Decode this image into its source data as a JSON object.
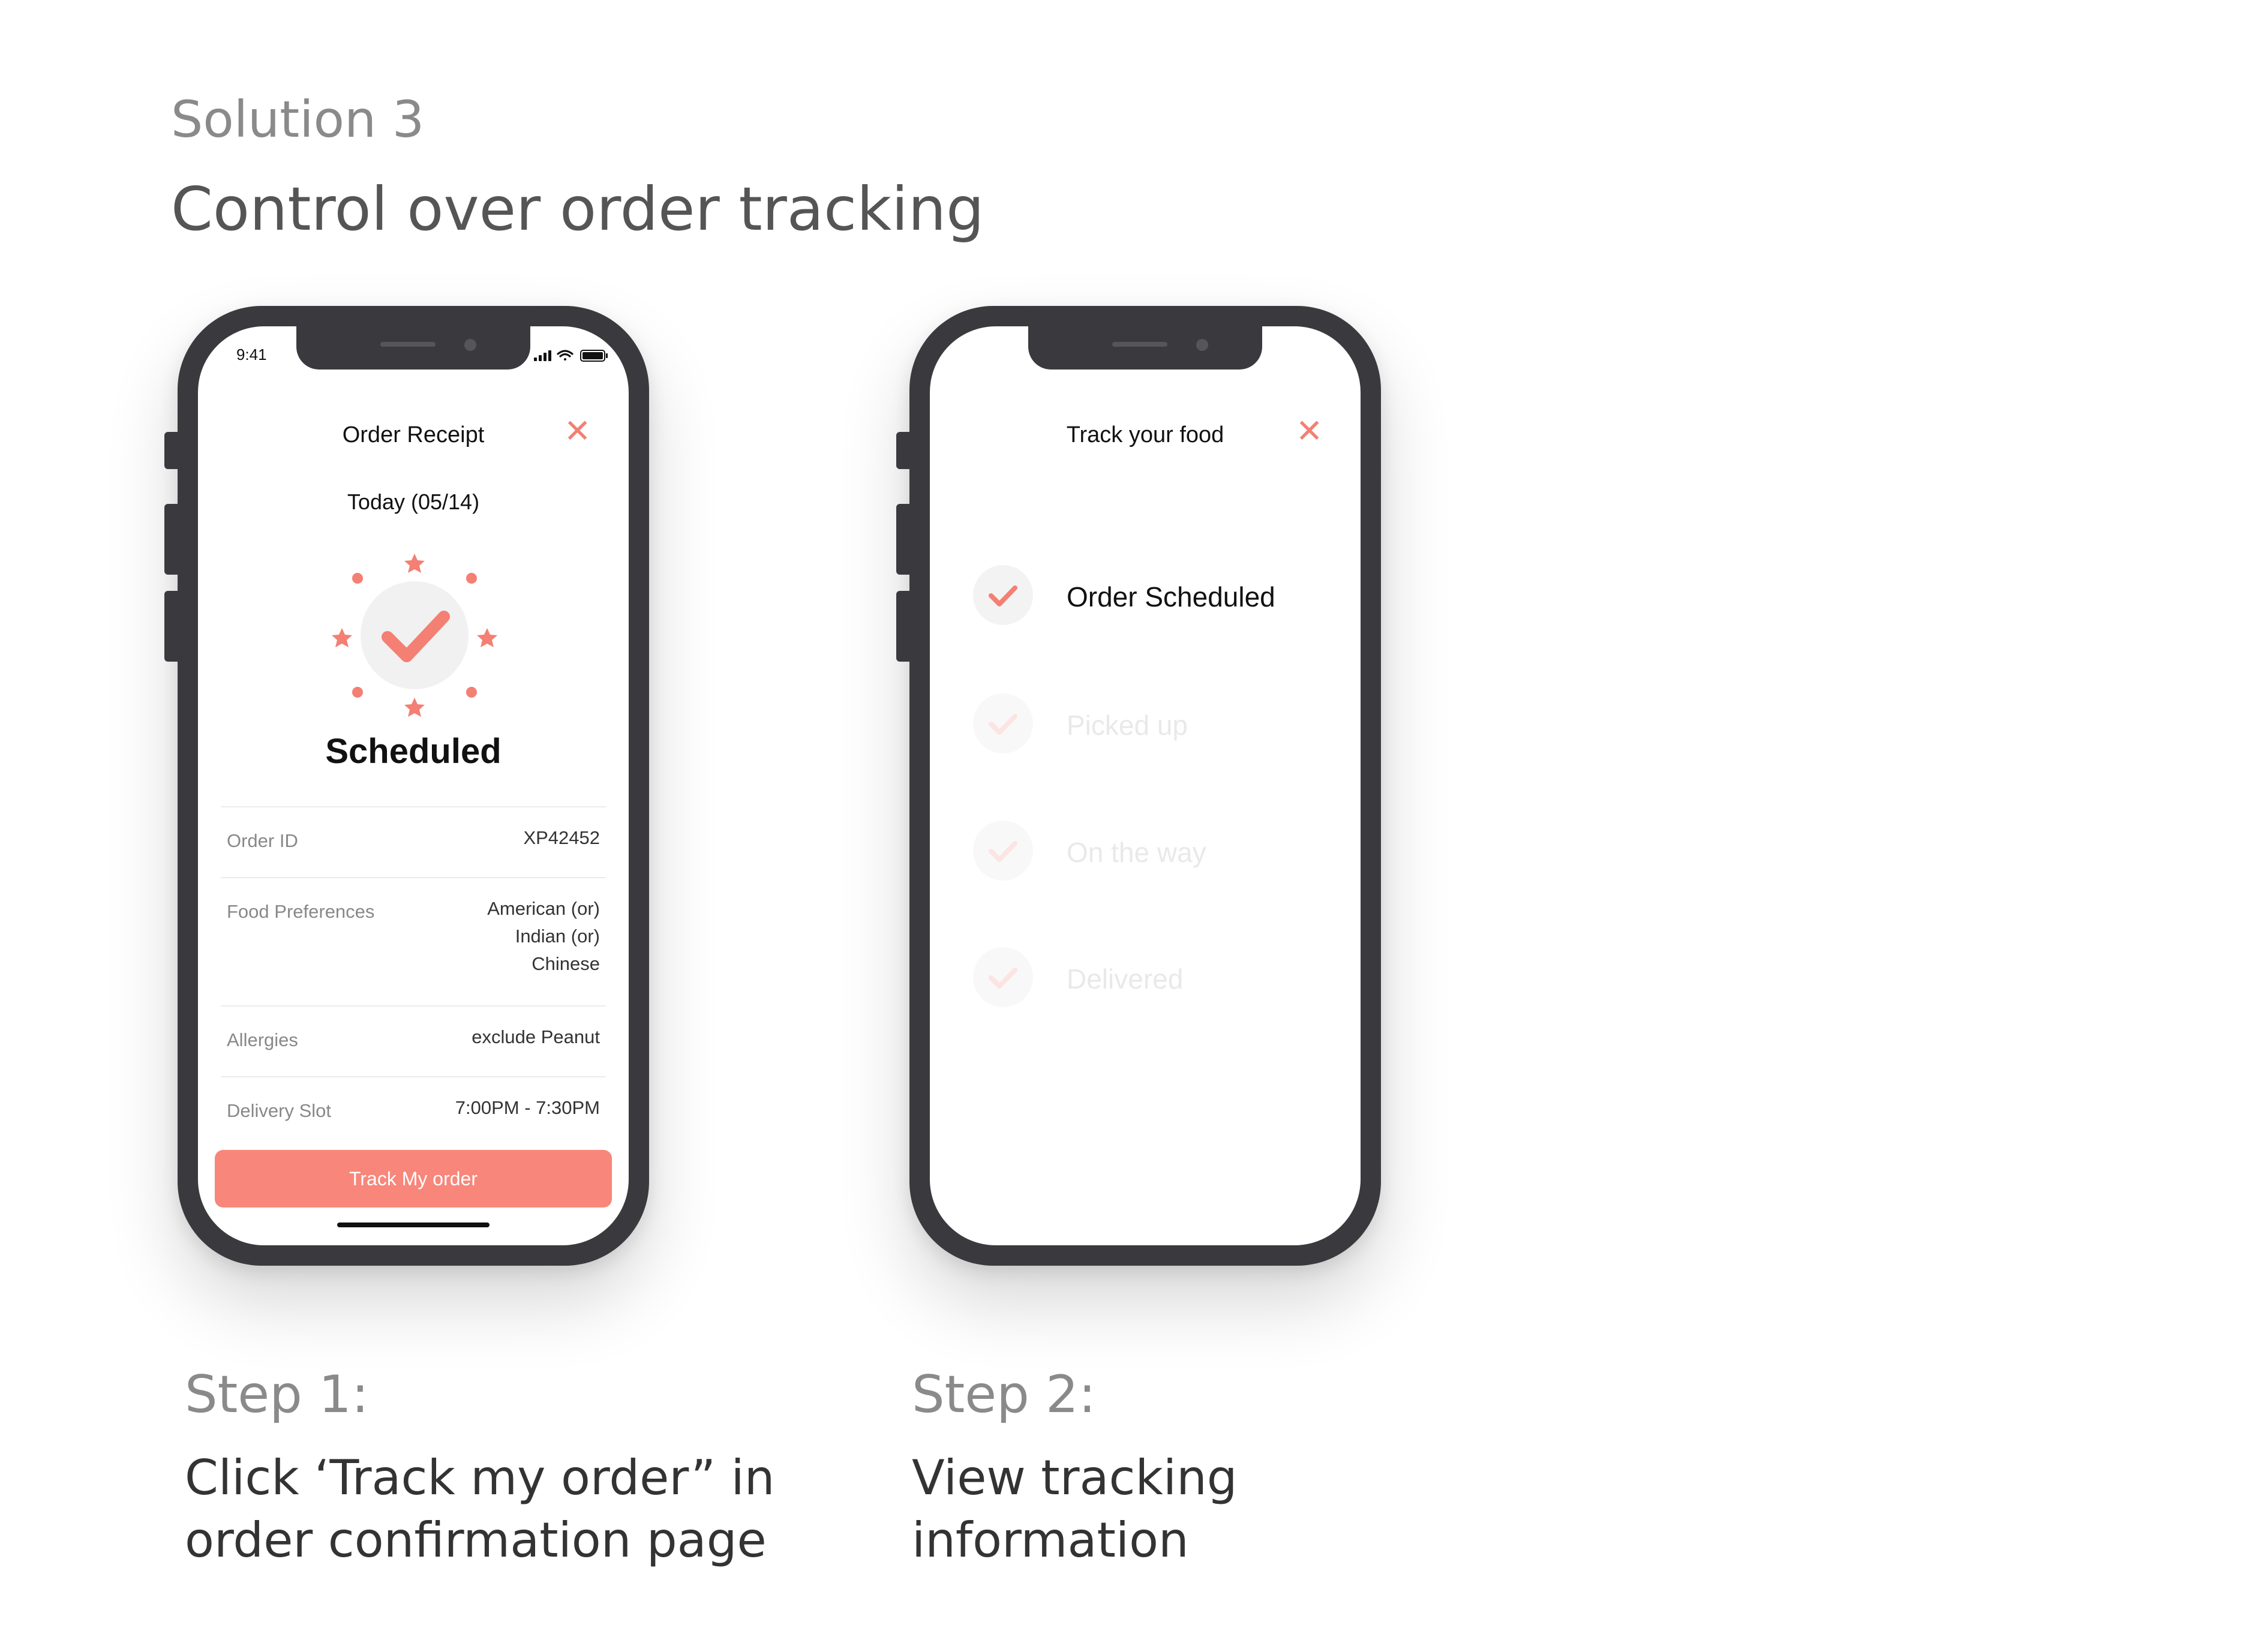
{
  "header": {
    "subtitle": "Solution 3",
    "title": "Control over order tracking"
  },
  "colors": {
    "accent": "#f8867a",
    "close": "#f47f73",
    "frame": "#3a3a3e"
  },
  "phone1": {
    "status_time": "9:41",
    "title": "Order Receipt",
    "close_icon": "close-icon",
    "date": "Today (05/14)",
    "status": "Scheduled",
    "details": [
      {
        "label": "Order ID",
        "value": "XP42452"
      },
      {
        "label": "Food Preferences",
        "value_lines": [
          "American (or)",
          "Indian (or)",
          "Chinese"
        ]
      },
      {
        "label": "Allergies",
        "value": "exclude Peanut"
      },
      {
        "label": "Delivery Slot",
        "value": "7:00PM - 7:30PM"
      }
    ],
    "button": "Track My order"
  },
  "phone2": {
    "title": "Track your food",
    "close_icon": "close-icon",
    "steps": [
      {
        "label": "Order Scheduled",
        "state": "done"
      },
      {
        "label": "Picked up",
        "state": "pending"
      },
      {
        "label": "On the way",
        "state": "pending"
      },
      {
        "label": "Delivered",
        "state": "pending"
      }
    ]
  },
  "captions": [
    {
      "heading": "Step 1:",
      "lines": [
        "Click ‘Track my order” in",
        "order confirmation page"
      ]
    },
    {
      "heading": "Step 2:",
      "lines": [
        "View tracking",
        "information"
      ]
    }
  ]
}
